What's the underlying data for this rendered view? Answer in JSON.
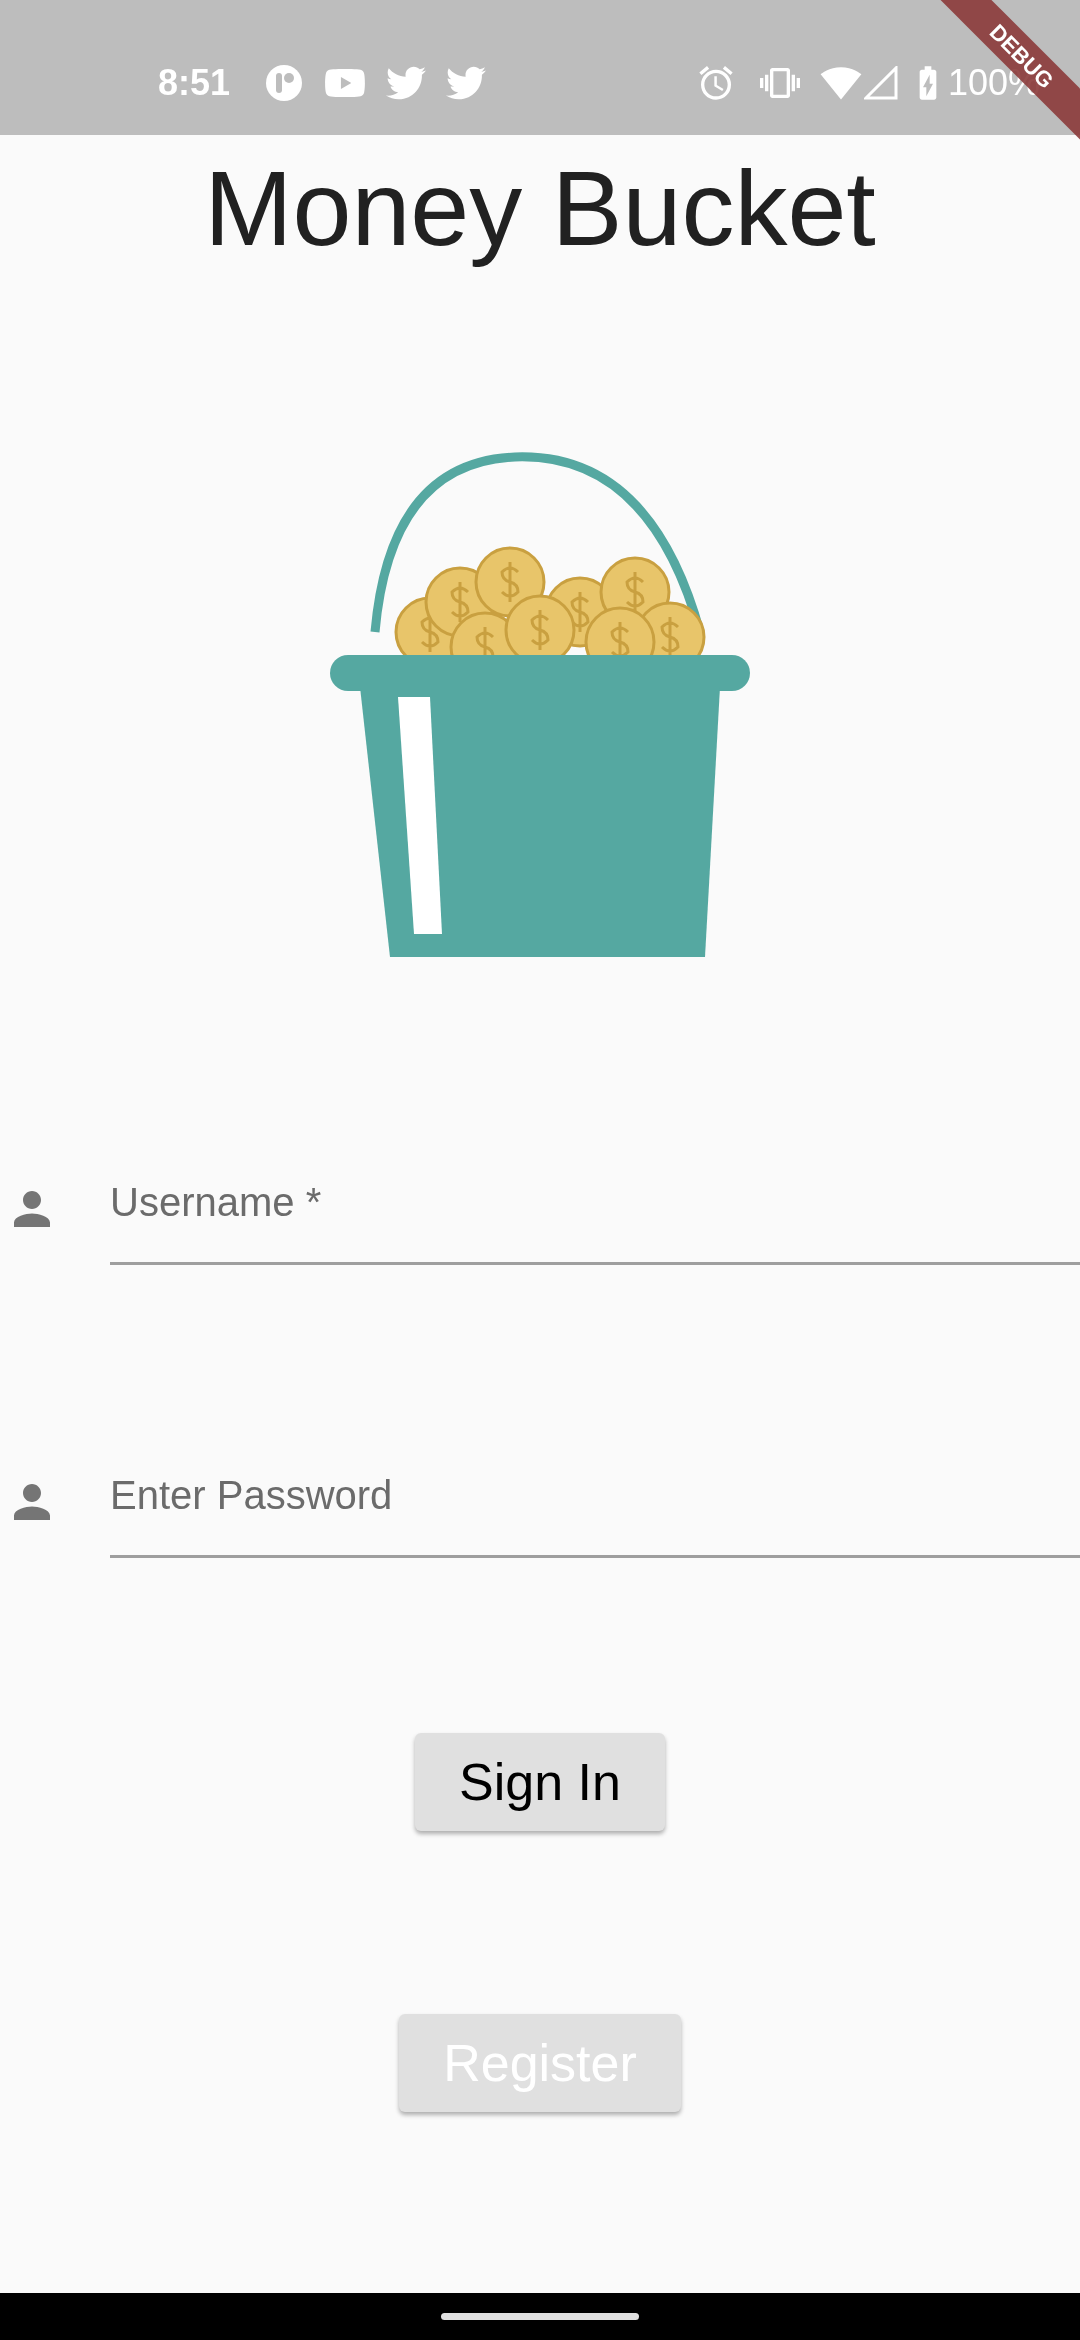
{
  "status_bar": {
    "time": "8:51",
    "battery": "100%"
  },
  "debug_banner": {
    "label": "DEBUG"
  },
  "title": "Money Bucket",
  "fields": [
    {
      "placeholder": "Username *"
    },
    {
      "placeholder": "Enter Password"
    }
  ],
  "buttons": [
    {
      "label": "Sign In",
      "disabled": false
    },
    {
      "label": "Register",
      "disabled": true
    }
  ]
}
